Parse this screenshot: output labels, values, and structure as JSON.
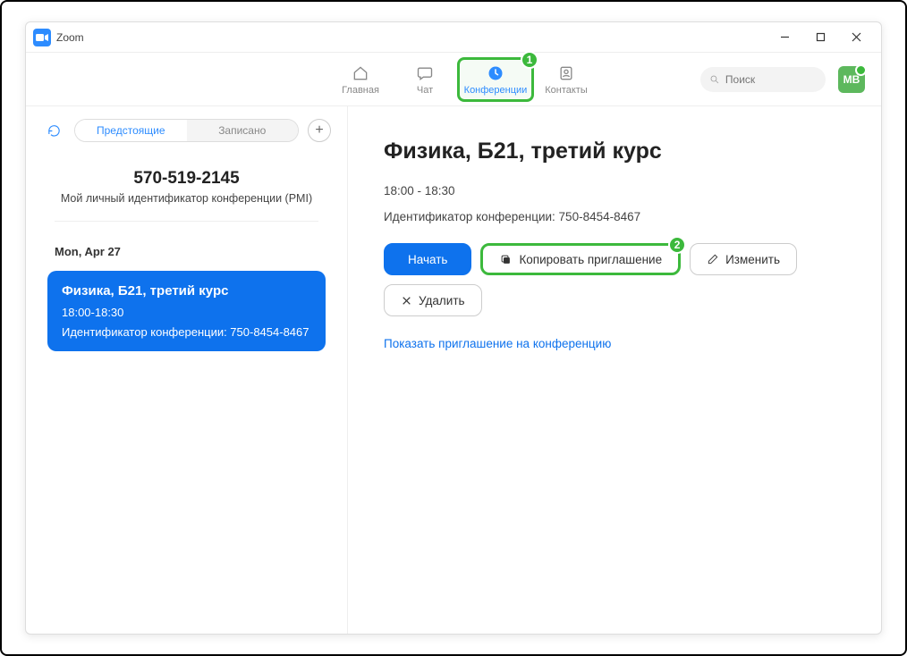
{
  "app_title": "Zoom",
  "nav": {
    "home": "Главная",
    "chat": "Чат",
    "meetings": "Конференции",
    "contacts": "Контакты"
  },
  "search": {
    "placeholder": "Поиск"
  },
  "avatar_initials": "МВ",
  "sidebar": {
    "tabs": {
      "upcoming": "Предстоящие",
      "recorded": "Записано"
    },
    "pmi_number": "570-519-2145",
    "pmi_label": "Мой личный идентификатор конференции (PMI)",
    "date_label": "Mon, Apr 27",
    "meeting": {
      "title": "Физика, Б21, третий курс",
      "time": "18:00-18:30",
      "id_line": "Идентификатор конференции: 750-8454-8467"
    }
  },
  "main": {
    "title": "Физика, Б21, третий курс",
    "time": "18:00 - 18:30",
    "id_line": "Идентификатор конференции: 750-8454-8467",
    "buttons": {
      "start": "Начать",
      "copy": "Копировать приглашение",
      "edit": "Изменить",
      "delete": "Удалить"
    },
    "show_invite_link": "Показать приглашение на конференцию"
  },
  "annot": {
    "one": "1",
    "two": "2"
  }
}
